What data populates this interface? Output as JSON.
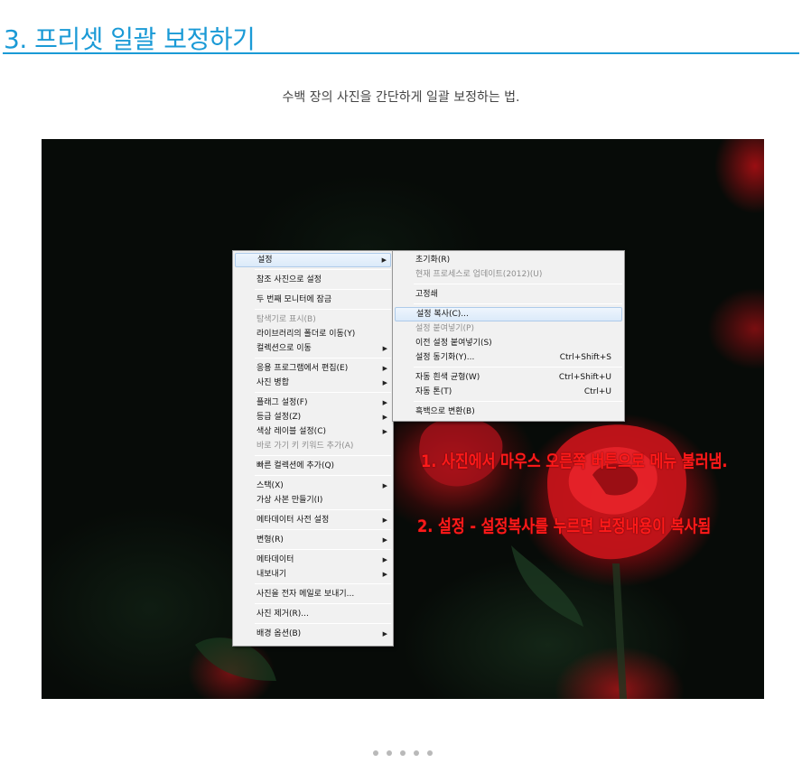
{
  "heading": "3. 프리셋 일괄 보정하기",
  "subtitle": "수백 장의 사진을 간단하게 일괄 보정하는 법.",
  "context_menu": {
    "items": [
      {
        "label": "설정",
        "submenu": true,
        "highlighted": true
      },
      {
        "label": "참조 사진으로 설정"
      },
      {
        "label": "두 번째 모니터에 잠금"
      },
      {
        "label": "탐색기로 표시(B)",
        "disabled": true
      },
      {
        "label": "라이브러리의 폴더로 이동(Y)"
      },
      {
        "label": "컬렉션으로 이동",
        "submenu": true
      },
      {
        "label": "응용 프로그램에서 편집(E)",
        "submenu": true
      },
      {
        "label": "사진 병합",
        "submenu": true
      },
      {
        "label": "플래그 설정(F)",
        "submenu": true
      },
      {
        "label": "등급 설정(Z)",
        "submenu": true
      },
      {
        "label": "색상 레이블 설정(C)",
        "submenu": true
      },
      {
        "label": "바로 가기 키 키워드 추가(A)",
        "disabled": true
      },
      {
        "label": "빠른 컬렉션에 추가(Q)"
      },
      {
        "label": "스택(X)",
        "submenu": true
      },
      {
        "label": "가상 사본 만들기(I)"
      },
      {
        "label": "메타데이터 사전 설정",
        "submenu": true
      },
      {
        "label": "변형(R)",
        "submenu": true
      },
      {
        "label": "메타데이터",
        "submenu": true
      },
      {
        "label": "내보내기",
        "submenu": true
      },
      {
        "label": "사진을 전자 메일로 보내기..."
      },
      {
        "label": "사진 제거(R)..."
      },
      {
        "label": "배경 옵션(B)",
        "submenu": true
      }
    ]
  },
  "submenu": {
    "items": [
      {
        "label": "초기화(R)"
      },
      {
        "label": "현재 프로세스로 업데이트(2012)(U)",
        "disabled": true
      },
      {
        "label": "고정쇄"
      },
      {
        "label": "설정 복사(C)...",
        "highlighted": true
      },
      {
        "label": "설정 붙여넣기(P)",
        "disabled": true
      },
      {
        "label": "이전 설정 붙여넣기(S)"
      },
      {
        "label": "설정 동기화(Y)...",
        "shortcut": "Ctrl+Shift+S"
      },
      {
        "label": "자동 흰색 균형(W)",
        "shortcut": "Ctrl+Shift+U"
      },
      {
        "label": "자동 톤(T)",
        "shortcut": "Ctrl+U"
      },
      {
        "label": "흑백으로 변환(B)"
      }
    ]
  },
  "annotations": {
    "line1": "1. 사진에서 마우스 오른쪽 버튼으로 메뉴 불러냄.",
    "line2": "2. 설정 - 설정복사를 누르면 보정내용이 복사됨"
  },
  "pagination": {
    "count": 5,
    "active_index": 0
  },
  "colors": {
    "accent": "#1a9ad6",
    "annotation": "#ff1a1a"
  },
  "icons": {
    "submenu_arrow": "▶"
  }
}
